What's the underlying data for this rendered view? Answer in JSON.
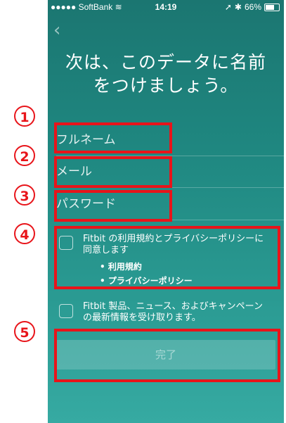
{
  "status_bar": {
    "carrier": "●●●●● SoftBank",
    "wifi": "≋",
    "time": "14:19",
    "location": "➚",
    "bluetooth": "✱",
    "battery": "66%"
  },
  "title_line1": "次は、このデータに名前",
  "title_line2": "をつけましょう。",
  "fields": {
    "fullname_placeholder": "フルネーム",
    "email_placeholder": "メール",
    "password_placeholder": "パスワード"
  },
  "terms": {
    "text_line1": "Fitbit の利用規約とプライバシーポリシーに",
    "text_line2": "同意します",
    "link_terms": "• 利用規約",
    "link_privacy": "• プライバシーポリシー"
  },
  "newsletter": {
    "text_line1": "Fitbit 製品、ニュース、およびキャンペーン",
    "text_line2": "の最新情報を受け取ります。"
  },
  "done_label": "完了",
  "annotations": [
    "1",
    "2",
    "3",
    "4",
    "5"
  ],
  "colors": {
    "accent_red": "#e8141a",
    "teal_top": "#1b7671",
    "teal_bottom": "#36aaa2"
  }
}
